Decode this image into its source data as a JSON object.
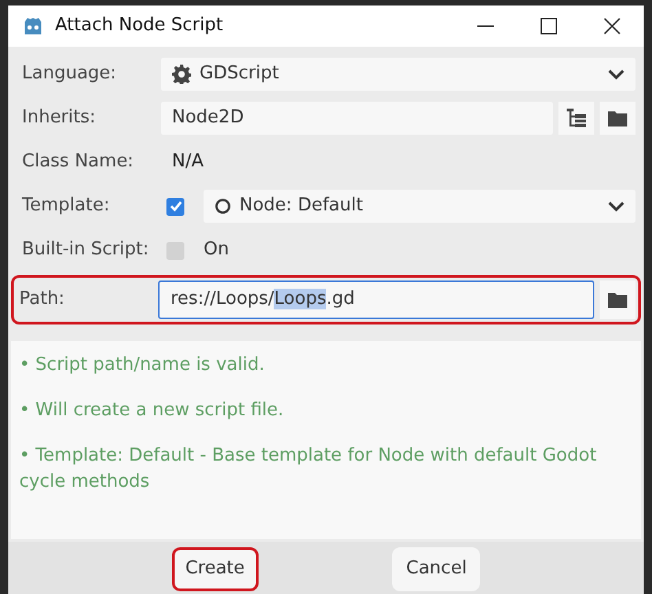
{
  "window": {
    "title": "Attach Node Script"
  },
  "form": {
    "language": {
      "label": "Language:",
      "value": "GDScript"
    },
    "inherits": {
      "label": "Inherits:",
      "value": "Node2D"
    },
    "class_name": {
      "label": "Class Name:",
      "value": "N/A"
    },
    "template": {
      "label": "Template:",
      "checked": true,
      "value": "Node: Default"
    },
    "built_in_script": {
      "label": "Built-in Script:",
      "checked": false,
      "option": "On"
    },
    "path": {
      "label": "Path:",
      "highlighted": true,
      "value": [
        {
          "text": "res://Loops/",
          "selected": false
        },
        {
          "text": "Loops",
          "selected": true
        },
        {
          "text": ".gd",
          "selected": false
        }
      ]
    }
  },
  "messages": [
    "•  Script path/name is valid.",
    "•  Will create a new script file.",
    "•  Template: Default - Base template for Node with default Godot cycle methods"
  ],
  "buttons": [
    {
      "label": "Create",
      "highlighted": true
    },
    {
      "label": "Cancel",
      "highlighted": false
    }
  ]
}
